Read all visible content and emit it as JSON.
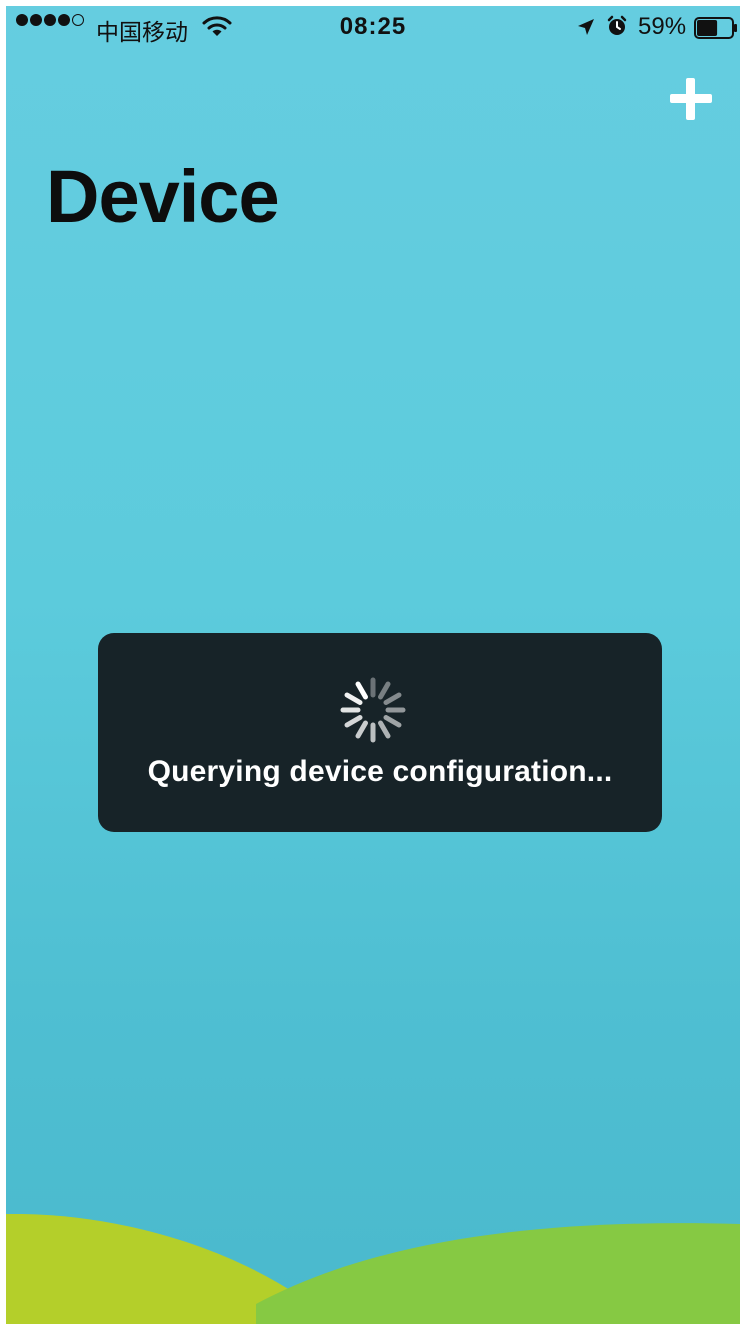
{
  "status_bar": {
    "carrier": "中国移动",
    "time": "08:25",
    "battery_percent": "59%",
    "signal_bars_filled": 4,
    "signal_bars_total": 5,
    "battery_level": 0.59
  },
  "header": {
    "add_icon": "plus-icon",
    "title": "Device"
  },
  "loading_hud": {
    "icon": "activity-spinner-icon",
    "message": "Querying device configuration..."
  },
  "colors": {
    "background_top": "#65cde0",
    "background_bottom": "#4ab9cd",
    "hud_background": "#172328",
    "hill_left": "#b4cf2a",
    "hill_right": "#86c943"
  }
}
